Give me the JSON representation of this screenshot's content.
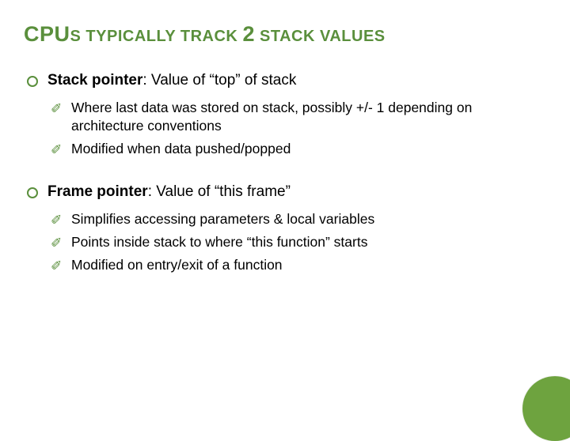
{
  "title": {
    "t1": "CPU",
    "t2": "S",
    "t3": " TYPICALLY TRACK ",
    "t4": "2",
    "t5": " STACK VALUES"
  },
  "colors": {
    "accent": "#5a8f3c"
  },
  "marker": "✐",
  "section1": {
    "heading_bold": "Stack pointer",
    "heading_rest": ": Value of “top” of stack",
    "items": [
      "Where last data was stored on stack, possibly +/- 1 depending on architecture conventions",
      "Modified when data pushed/popped"
    ]
  },
  "section2": {
    "heading_bold": "Frame pointer",
    "heading_rest": ": Value of “this frame”",
    "items": [
      "Simplifies accessing parameters & local variables",
      "Points inside stack to where “this function” starts",
      "Modified on entry/exit of a function"
    ]
  }
}
